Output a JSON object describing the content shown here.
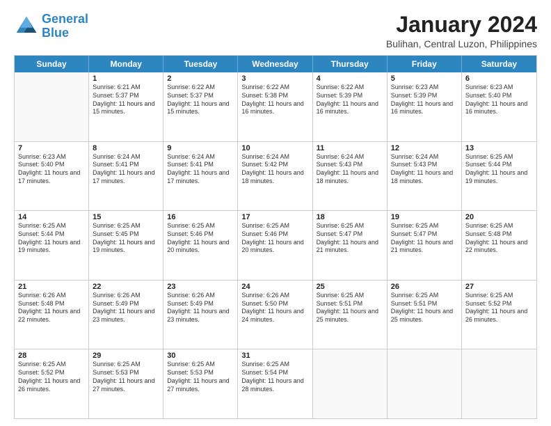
{
  "header": {
    "logo_line1": "General",
    "logo_line2": "Blue",
    "month_title": "January 2024",
    "location": "Bulihan, Central Luzon, Philippines"
  },
  "days_of_week": [
    "Sunday",
    "Monday",
    "Tuesday",
    "Wednesday",
    "Thursday",
    "Friday",
    "Saturday"
  ],
  "weeks": [
    [
      {
        "day": "",
        "sunrise": "",
        "sunset": "",
        "daylight": ""
      },
      {
        "day": "1",
        "sunrise": "Sunrise: 6:21 AM",
        "sunset": "Sunset: 5:37 PM",
        "daylight": "Daylight: 11 hours and 15 minutes."
      },
      {
        "day": "2",
        "sunrise": "Sunrise: 6:22 AM",
        "sunset": "Sunset: 5:37 PM",
        "daylight": "Daylight: 11 hours and 15 minutes."
      },
      {
        "day": "3",
        "sunrise": "Sunrise: 6:22 AM",
        "sunset": "Sunset: 5:38 PM",
        "daylight": "Daylight: 11 hours and 16 minutes."
      },
      {
        "day": "4",
        "sunrise": "Sunrise: 6:22 AM",
        "sunset": "Sunset: 5:39 PM",
        "daylight": "Daylight: 11 hours and 16 minutes."
      },
      {
        "day": "5",
        "sunrise": "Sunrise: 6:23 AM",
        "sunset": "Sunset: 5:39 PM",
        "daylight": "Daylight: 11 hours and 16 minutes."
      },
      {
        "day": "6",
        "sunrise": "Sunrise: 6:23 AM",
        "sunset": "Sunset: 5:40 PM",
        "daylight": "Daylight: 11 hours and 16 minutes."
      }
    ],
    [
      {
        "day": "7",
        "sunrise": "Sunrise: 6:23 AM",
        "sunset": "Sunset: 5:40 PM",
        "daylight": "Daylight: 11 hours and 17 minutes."
      },
      {
        "day": "8",
        "sunrise": "Sunrise: 6:24 AM",
        "sunset": "Sunset: 5:41 PM",
        "daylight": "Daylight: 11 hours and 17 minutes."
      },
      {
        "day": "9",
        "sunrise": "Sunrise: 6:24 AM",
        "sunset": "Sunset: 5:41 PM",
        "daylight": "Daylight: 11 hours and 17 minutes."
      },
      {
        "day": "10",
        "sunrise": "Sunrise: 6:24 AM",
        "sunset": "Sunset: 5:42 PM",
        "daylight": "Daylight: 11 hours and 18 minutes."
      },
      {
        "day": "11",
        "sunrise": "Sunrise: 6:24 AM",
        "sunset": "Sunset: 5:43 PM",
        "daylight": "Daylight: 11 hours and 18 minutes."
      },
      {
        "day": "12",
        "sunrise": "Sunrise: 6:24 AM",
        "sunset": "Sunset: 5:43 PM",
        "daylight": "Daylight: 11 hours and 18 minutes."
      },
      {
        "day": "13",
        "sunrise": "Sunrise: 6:25 AM",
        "sunset": "Sunset: 5:44 PM",
        "daylight": "Daylight: 11 hours and 19 minutes."
      }
    ],
    [
      {
        "day": "14",
        "sunrise": "Sunrise: 6:25 AM",
        "sunset": "Sunset: 5:44 PM",
        "daylight": "Daylight: 11 hours and 19 minutes."
      },
      {
        "day": "15",
        "sunrise": "Sunrise: 6:25 AM",
        "sunset": "Sunset: 5:45 PM",
        "daylight": "Daylight: 11 hours and 19 minutes."
      },
      {
        "day": "16",
        "sunrise": "Sunrise: 6:25 AM",
        "sunset": "Sunset: 5:46 PM",
        "daylight": "Daylight: 11 hours and 20 minutes."
      },
      {
        "day": "17",
        "sunrise": "Sunrise: 6:25 AM",
        "sunset": "Sunset: 5:46 PM",
        "daylight": "Daylight: 11 hours and 20 minutes."
      },
      {
        "day": "18",
        "sunrise": "Sunrise: 6:25 AM",
        "sunset": "Sunset: 5:47 PM",
        "daylight": "Daylight: 11 hours and 21 minutes."
      },
      {
        "day": "19",
        "sunrise": "Sunrise: 6:25 AM",
        "sunset": "Sunset: 5:47 PM",
        "daylight": "Daylight: 11 hours and 21 minutes."
      },
      {
        "day": "20",
        "sunrise": "Sunrise: 6:25 AM",
        "sunset": "Sunset: 5:48 PM",
        "daylight": "Daylight: 11 hours and 22 minutes."
      }
    ],
    [
      {
        "day": "21",
        "sunrise": "Sunrise: 6:26 AM",
        "sunset": "Sunset: 5:48 PM",
        "daylight": "Daylight: 11 hours and 22 minutes."
      },
      {
        "day": "22",
        "sunrise": "Sunrise: 6:26 AM",
        "sunset": "Sunset: 5:49 PM",
        "daylight": "Daylight: 11 hours and 23 minutes."
      },
      {
        "day": "23",
        "sunrise": "Sunrise: 6:26 AM",
        "sunset": "Sunset: 5:49 PM",
        "daylight": "Daylight: 11 hours and 23 minutes."
      },
      {
        "day": "24",
        "sunrise": "Sunrise: 6:26 AM",
        "sunset": "Sunset: 5:50 PM",
        "daylight": "Daylight: 11 hours and 24 minutes."
      },
      {
        "day": "25",
        "sunrise": "Sunrise: 6:25 AM",
        "sunset": "Sunset: 5:51 PM",
        "daylight": "Daylight: 11 hours and 25 minutes."
      },
      {
        "day": "26",
        "sunrise": "Sunrise: 6:25 AM",
        "sunset": "Sunset: 5:51 PM",
        "daylight": "Daylight: 11 hours and 25 minutes."
      },
      {
        "day": "27",
        "sunrise": "Sunrise: 6:25 AM",
        "sunset": "Sunset: 5:52 PM",
        "daylight": "Daylight: 11 hours and 26 minutes."
      }
    ],
    [
      {
        "day": "28",
        "sunrise": "Sunrise: 6:25 AM",
        "sunset": "Sunset: 5:52 PM",
        "daylight": "Daylight: 11 hours and 26 minutes."
      },
      {
        "day": "29",
        "sunrise": "Sunrise: 6:25 AM",
        "sunset": "Sunset: 5:53 PM",
        "daylight": "Daylight: 11 hours and 27 minutes."
      },
      {
        "day": "30",
        "sunrise": "Sunrise: 6:25 AM",
        "sunset": "Sunset: 5:53 PM",
        "daylight": "Daylight: 11 hours and 27 minutes."
      },
      {
        "day": "31",
        "sunrise": "Sunrise: 6:25 AM",
        "sunset": "Sunset: 5:54 PM",
        "daylight": "Daylight: 11 hours and 28 minutes."
      },
      {
        "day": "",
        "sunrise": "",
        "sunset": "",
        "daylight": ""
      },
      {
        "day": "",
        "sunrise": "",
        "sunset": "",
        "daylight": ""
      },
      {
        "day": "",
        "sunrise": "",
        "sunset": "",
        "daylight": ""
      }
    ]
  ]
}
